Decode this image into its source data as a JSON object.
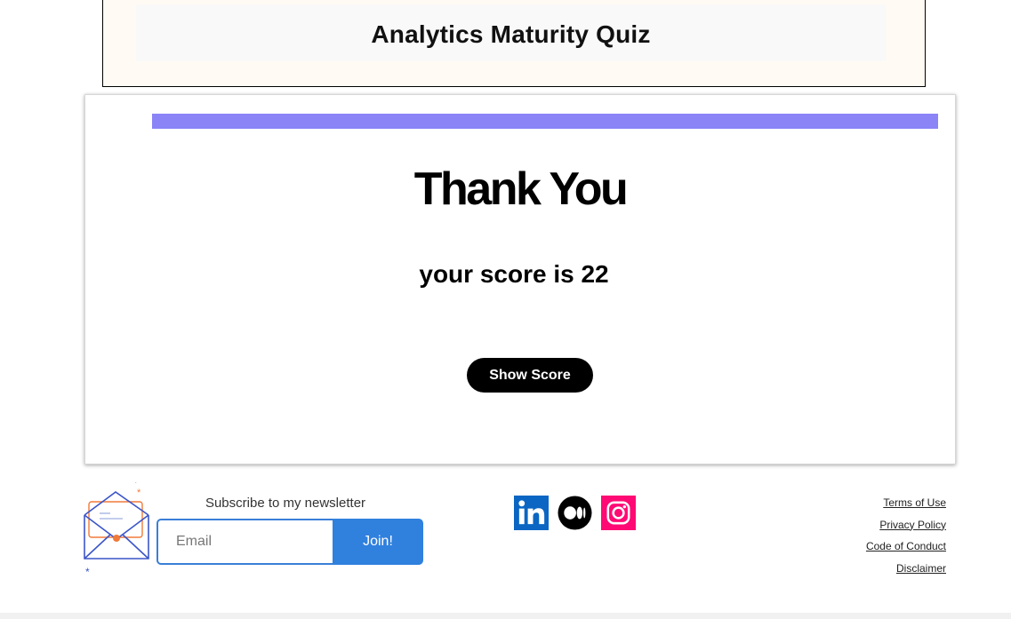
{
  "header": {
    "title": "Analytics Maturity Quiz"
  },
  "quiz": {
    "progress_fraction": 1.0,
    "progress_color": "#8a84f7",
    "heading": "Thank You",
    "score_text": "your score is 22",
    "show_score_label": "Show Score"
  },
  "footer": {
    "newsletter_label": "Subscribe to my newsletter",
    "email_placeholder": "Email",
    "join_label": "Join!",
    "accent_color": "#3080de",
    "socials": [
      {
        "name": "linkedin-icon",
        "color": "#0a66c2"
      },
      {
        "name": "medium-icon",
        "color": "#000000"
      },
      {
        "name": "instagram-icon",
        "color": "#ff0a74"
      }
    ],
    "links": [
      "Terms of Use",
      "Privacy Policy",
      "Code of Conduct",
      "Disclaimer"
    ]
  }
}
